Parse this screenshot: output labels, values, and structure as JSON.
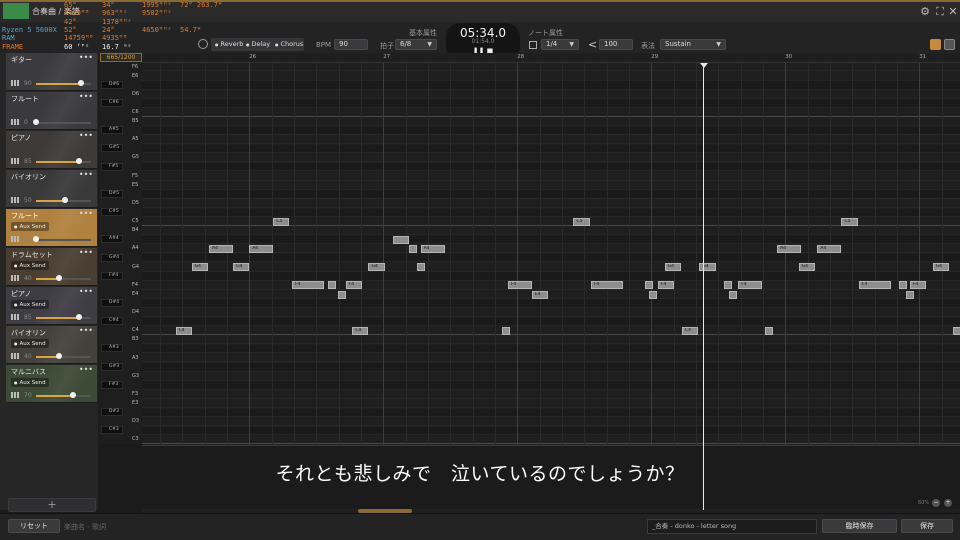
{
  "window": {
    "title": "合奏曲 / 楽譜",
    "accent_color": "#d9a441"
  },
  "perf_overlay": {
    "rows": [
      {
        "label": "",
        "a": "65°",
        "b": "34°",
        "c": "1995ᴹᴴᶻ",
        "d": "72° 263.7ᵂ"
      },
      {
        "label": "",
        "a": "4429ᴹᴮ",
        "b": "963ᴹᴴᶻ",
        "c": "9502ᴹᴴᶻ",
        "d": ""
      },
      {
        "label": "",
        "a": "42°",
        "b": "1378ᴹᴴᶻ",
        "c": "",
        "d": ""
      },
      {
        "label": "Ryzen 5 5600X",
        "a": "52°",
        "b": "24°",
        "c": "4650ᴹᴴᶻ",
        "d": "54.7ᵂ"
      },
      {
        "label": "RAM",
        "a": "14759ᴹᴮ",
        "b": "4935ᴹᴮ",
        "c": "",
        "d": ""
      },
      {
        "label": "FRAME",
        "a": "60 ᶠᴾˢ",
        "b": "16.7 ᵐˢ",
        "c": "",
        "d": ""
      }
    ]
  },
  "toolbar": {
    "effects": [
      "Reverb",
      "Delay",
      "Chorus"
    ],
    "bpm_label": "BPM",
    "bpm_value": "90",
    "beat_label": "拍子",
    "beat_value": "6/8",
    "basic_attr_label": "基本属性",
    "clock_main": "05:34.0",
    "clock_sub": "01:54.0",
    "clock_controls": "❚❚ ■",
    "note_attr_label": "ノート属性",
    "quant_value": "1/4",
    "velocity_value": "100",
    "expression_label": "表法",
    "expression_value": "Sustain"
  },
  "tracks": [
    {
      "name": "ギター",
      "vol": "90",
      "level": 0.82,
      "aux": "",
      "selected": false
    },
    {
      "name": "フルート",
      "vol": "0",
      "level": 0.0,
      "aux": "",
      "selected": false
    },
    {
      "name": "ピアノ",
      "vol": "85",
      "level": 0.78,
      "aux": "",
      "selected": false
    },
    {
      "name": "バイオリン",
      "vol": "50",
      "level": 0.52,
      "aux": "",
      "selected": false
    },
    {
      "name": "フルート",
      "vol": "0",
      "level": 0.0,
      "aux": "Aux Send",
      "selected": true
    },
    {
      "name": "ドラムセット",
      "vol": "40",
      "level": 0.42,
      "aux": "Aux Send",
      "selected": false
    },
    {
      "name": "ピアノ",
      "vol": "85",
      "level": 0.78,
      "aux": "Aux Send",
      "selected": false
    },
    {
      "name": "バイオリン",
      "vol": "40",
      "level": 0.42,
      "aux": "Aux Send",
      "selected": false
    },
    {
      "name": "マルニバス",
      "vol": "70",
      "level": 0.68,
      "aux": "Aux Send",
      "selected": false
    }
  ],
  "position_label": "665/1200",
  "measures": [
    "26",
    "27",
    "28",
    "29",
    "30",
    "31"
  ],
  "keys": [
    {
      "name": "F6",
      "black": false
    },
    {
      "name": "E6",
      "black": false
    },
    {
      "name": "D#6",
      "black": true
    },
    {
      "name": "D6",
      "black": false
    },
    {
      "name": "C#6",
      "black": true
    },
    {
      "name": "C6",
      "black": false
    },
    {
      "name": "B5",
      "black": false
    },
    {
      "name": "A#5",
      "black": true
    },
    {
      "name": "A5",
      "black": false
    },
    {
      "name": "G#5",
      "black": true
    },
    {
      "name": "G5",
      "black": false
    },
    {
      "name": "F#5",
      "black": true
    },
    {
      "name": "F5",
      "black": false
    },
    {
      "name": "E5",
      "black": false
    },
    {
      "name": "D#5",
      "black": true
    },
    {
      "name": "D5",
      "black": false
    },
    {
      "name": "C#5",
      "black": true
    },
    {
      "name": "C5",
      "black": false
    },
    {
      "name": "B4",
      "black": false
    },
    {
      "name": "A#4",
      "black": true
    },
    {
      "name": "A4",
      "black": false
    },
    {
      "name": "G#4",
      "black": true
    },
    {
      "name": "G4",
      "black": false
    },
    {
      "name": "F#4",
      "black": true
    },
    {
      "name": "F4",
      "black": false
    },
    {
      "name": "E4",
      "black": false
    },
    {
      "name": "D#4",
      "black": true
    },
    {
      "name": "D4",
      "black": false
    },
    {
      "name": "C#4",
      "black": true
    },
    {
      "name": "C4",
      "black": false
    },
    {
      "name": "B3",
      "black": false
    },
    {
      "name": "A#3",
      "black": true
    },
    {
      "name": "A3",
      "black": false
    },
    {
      "name": "G#3",
      "black": true
    },
    {
      "name": "G3",
      "black": false
    },
    {
      "name": "F#3",
      "black": true
    },
    {
      "name": "F3",
      "black": false
    },
    {
      "name": "E3",
      "black": false
    },
    {
      "name": "D#3",
      "black": true
    },
    {
      "name": "D3",
      "black": false
    },
    {
      "name": "C#3",
      "black": true
    },
    {
      "name": "C3",
      "black": false
    }
  ],
  "notes": [
    {
      "pitch": "F4",
      "start": 25.0,
      "len": 0.2,
      "label": ""
    },
    {
      "pitch": "C4",
      "start": 25.45,
      "len": 0.12,
      "label": "C4"
    },
    {
      "pitch": "G4",
      "start": 25.57,
      "len": 0.12,
      "label": "G4"
    },
    {
      "pitch": "A4",
      "start": 25.7,
      "len": 0.18,
      "label": "A4"
    },
    {
      "pitch": "G4",
      "start": 25.88,
      "len": 0.12,
      "label": "G4"
    },
    {
      "pitch": "A4",
      "start": 26.0,
      "len": 0.18,
      "label": "A4"
    },
    {
      "pitch": "C5",
      "start": 26.18,
      "len": 0.12,
      "label": "C5"
    },
    {
      "pitch": "F4",
      "start": 26.32,
      "len": 0.24,
      "label": "F4"
    },
    {
      "pitch": "F4",
      "start": 26.59,
      "len": 0.06,
      "label": ""
    },
    {
      "pitch": "E4",
      "start": 26.66,
      "len": 0.06,
      "label": ""
    },
    {
      "pitch": "F4",
      "start": 26.72,
      "len": 0.12,
      "label": "F4"
    },
    {
      "pitch": "C4",
      "start": 26.77,
      "len": 0.12,
      "label": "C4"
    },
    {
      "pitch": "G4",
      "start": 26.89,
      "len": 0.12,
      "label": "G4"
    },
    {
      "pitch": "A#4",
      "start": 27.07,
      "len": 0.12,
      "label": ""
    },
    {
      "pitch": "A4",
      "start": 27.19,
      "len": 0.06,
      "label": ""
    },
    {
      "pitch": "A4",
      "start": 27.28,
      "len": 0.18,
      "label": "A4"
    },
    {
      "pitch": "G4",
      "start": 27.25,
      "len": 0.06,
      "label": ""
    },
    {
      "pitch": "C4",
      "start": 27.89,
      "len": 0.06,
      "label": ""
    },
    {
      "pitch": "F4",
      "start": 27.93,
      "len": 0.18,
      "label": "F4"
    },
    {
      "pitch": "E4",
      "start": 28.11,
      "len": 0.12,
      "label": "E4"
    },
    {
      "pitch": "C5",
      "start": 28.42,
      "len": 0.12,
      "label": "C5"
    },
    {
      "pitch": "F4",
      "start": 28.55,
      "len": 0.24,
      "label": "F4"
    },
    {
      "pitch": "F4",
      "start": 28.95,
      "len": 0.06,
      "label": ""
    },
    {
      "pitch": "E4",
      "start": 28.98,
      "len": 0.06,
      "label": ""
    },
    {
      "pitch": "F4",
      "start": 29.05,
      "len": 0.12,
      "label": "F4"
    },
    {
      "pitch": "G4",
      "start": 29.1,
      "len": 0.12,
      "label": "G4"
    },
    {
      "pitch": "C4",
      "start": 29.23,
      "len": 0.12,
      "label": "C4"
    },
    {
      "pitch": "G4",
      "start": 29.36,
      "len": 0.12,
      "label": "G4"
    },
    {
      "pitch": "F4",
      "start": 29.54,
      "len": 0.06,
      "label": ""
    },
    {
      "pitch": "E4",
      "start": 29.58,
      "len": 0.06,
      "label": ""
    },
    {
      "pitch": "F4",
      "start": 29.65,
      "len": 0.18,
      "label": "F4"
    },
    {
      "pitch": "C4",
      "start": 29.85,
      "len": 0.06,
      "label": ""
    },
    {
      "pitch": "A4",
      "start": 29.94,
      "len": 0.18,
      "label": "A4"
    },
    {
      "pitch": "G4",
      "start": 30.1,
      "len": 0.12,
      "label": "G4"
    },
    {
      "pitch": "A4",
      "start": 30.24,
      "len": 0.18,
      "label": "A4"
    },
    {
      "pitch": "C5",
      "start": 30.42,
      "len": 0.12,
      "label": "C5"
    },
    {
      "pitch": "F4",
      "start": 30.55,
      "len": 0.24,
      "label": "F4"
    },
    {
      "pitch": "F4",
      "start": 30.85,
      "len": 0.06,
      "label": ""
    },
    {
      "pitch": "E4",
      "start": 30.9,
      "len": 0.06,
      "label": ""
    },
    {
      "pitch": "F4",
      "start": 30.93,
      "len": 0.12,
      "label": "F4"
    },
    {
      "pitch": "G4",
      "start": 31.1,
      "len": 0.12,
      "label": "G4"
    },
    {
      "pitch": "C4",
      "start": 31.25,
      "len": 0.06,
      "label": ""
    }
  ],
  "lyric": "それとも悲しみで　泣いているのでしょうか？",
  "zoom_label": "60%",
  "bottom": {
    "reset_label": "リセット",
    "status_text": "楽曲名 - 歌詞",
    "song_field": "_合奏 - donko - letter song",
    "temp_save_label": "臨時保存",
    "save_label": "保存"
  }
}
